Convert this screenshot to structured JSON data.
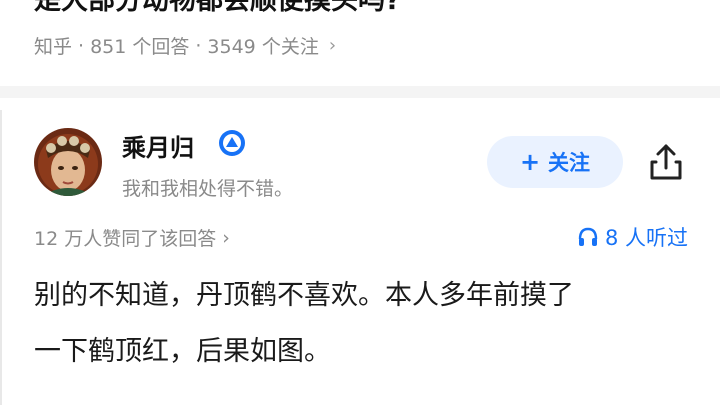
{
  "question": {
    "title": "是大部分动物都会顺便摸头吗?",
    "source": "知乎",
    "answers_count": "851 个回答",
    "followers_count": "3549 个关注"
  },
  "author": {
    "name": "乘月归",
    "bio": "我和我相处得不错。",
    "follow_label": "关注"
  },
  "stats": {
    "approve_text": "12 万人赞同了该回答",
    "listen_text": "8 人听过"
  },
  "answer": {
    "line1": "别的不知道，丹顶鹤不喜欢。本人多年前摸了",
    "line2": "一下鹤顶红，后果如图。"
  },
  "colors": {
    "accent": "#1772f6",
    "follow_bg": "#eaf2ff",
    "muted": "#8a8a8a"
  },
  "icons": {
    "badge": "verified-badge-icon",
    "share": "share-icon",
    "headphones": "headphones-icon",
    "chevron": "chevron-right-icon"
  }
}
